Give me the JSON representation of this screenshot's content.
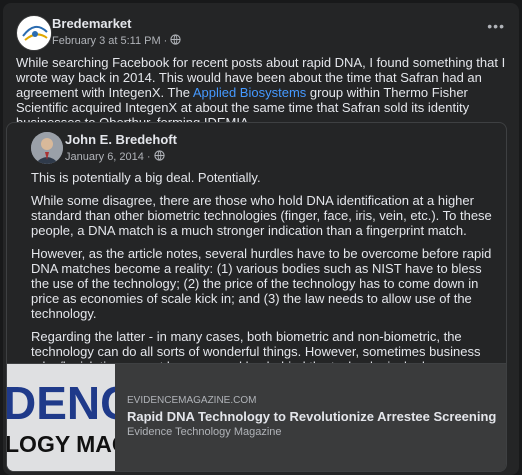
{
  "post": {
    "author": "Bredemarket",
    "date": "February 3 at 5:11 PM",
    "sep": "·",
    "body_before_link": "While searching Facebook for recent posts about rapid DNA, I found something that I wrote way back in 2014. This would have been about the time that Safran had an agreement with IntegenX. The ",
    "link_text": "Applied Biosystems",
    "body_after_link": " group within Thermo Fisher Scientific acquired IntegenX at about the same time that Safran sold its identity businesses to Oberthur, forming IDEMIA.",
    "more_icon": "ellipsis-icon",
    "privacy_icon": "globe-icon"
  },
  "shared": {
    "author": "John E. Bredehoft",
    "date": "January 6, 2014",
    "sep": "·",
    "paragraphs": [
      "This is potentially a big deal. Potentially.",
      "While some disagree, there are those who hold DNA identification at a higher standard than other biometric technologies (finger, face, iris, vein, etc.). To these people, a DNA match is a much stronger indication than a fingerprint match.",
      "However, as the article notes, several hurdles have to be overcome before rapid DNA matches become a reality: (1) various bodies such as NIST have to bless the use of the technology; (2) the price of the technology has to come down in price as economies of scale kick in; and (3) the law needs to allow use of the technology.",
      "Regarding the latter - in many cases, both biometric and non-biometric, the technology can do all sorts of wonderful things. However, sometimes business rules/legislation cannot keep up, and lag behind the technological advances. Depending upon your opinion of a particular technology, this can be a bad thing, or perhaps a good thing."
    ]
  },
  "link_preview": {
    "domain": "EVIDENCEMAGAZINE.COM",
    "title": "Rapid DNA Technology to Revolutionize Arrestee Screening",
    "subtitle": "Evidence Technology Magazine",
    "image_line1": "DENC",
    "image_line2": "LOGY MAG"
  },
  "colors": {
    "card": "#242526",
    "link": "#4599ff",
    "logo_blue": "#1f3a8a"
  }
}
